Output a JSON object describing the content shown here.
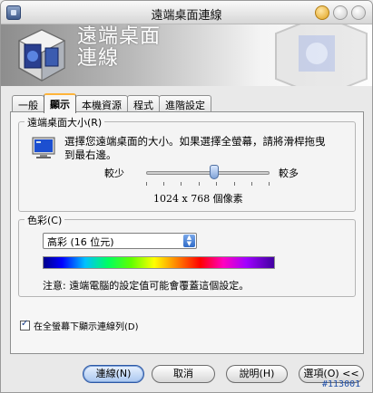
{
  "window": {
    "title": "遠端桌面連線"
  },
  "banner": {
    "line1": "遠端桌面",
    "line2": "連線"
  },
  "tabs": [
    {
      "label": "一般"
    },
    {
      "label": "顯示"
    },
    {
      "label": "本機資源"
    },
    {
      "label": "程式"
    },
    {
      "label": "進階設定"
    }
  ],
  "active_tab": "顯示",
  "size_group": {
    "label": "遠端桌面大小(R)",
    "description": "選擇您遠端桌面的大小。如果選擇全螢幕，請將滑桿拖曳到最右邊。",
    "less_label": "較少",
    "more_label": "較多",
    "resolution": "1024 x 768 個像素",
    "slider_level": 0.55
  },
  "color_group": {
    "label": "色彩(C)",
    "selected": "高彩 (16 位元)",
    "note": "注意: 遠端電腦的設定值可能會覆蓋這個設定。"
  },
  "fullscreen_bar": {
    "label": "在全螢幕下顯示連線列(D)",
    "checked": true
  },
  "buttons": {
    "connect": "連線(N)",
    "cancel": "取消",
    "help": "說明(H)",
    "options": "選項(O) <<"
  },
  "watermark": "#113001",
  "colors": {
    "accent_tab": "#ffb43a",
    "default_button": "#a9c6ef"
  }
}
